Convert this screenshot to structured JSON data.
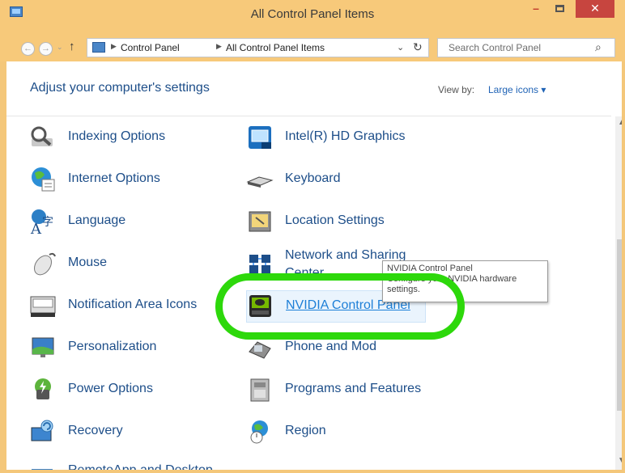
{
  "window": {
    "title": "All Control Panel Items"
  },
  "titlebar_buttons": {
    "minimize": "–",
    "close": "✕"
  },
  "nav": {
    "back": "←",
    "forward": "→",
    "up": "↑",
    "dropdown": "⌄"
  },
  "breadcrumb": [
    "Control Panel",
    "All Control Panel Items"
  ],
  "address": {
    "dropdown_glyph": "⌄",
    "refresh_glyph": "↻"
  },
  "search": {
    "placeholder": "Search Control Panel",
    "icon_glyph": "⌕"
  },
  "header": {
    "title": "Adjust your computer's settings",
    "view_by_label": "View by:",
    "view_by_value": "Large icons ▾"
  },
  "items_left": [
    {
      "label": "Indexing Options",
      "icon": "magnifier-icon"
    },
    {
      "label": "Internet Options",
      "icon": "globe-icon"
    },
    {
      "label": "Language",
      "icon": "language-icon"
    },
    {
      "label": "Mouse",
      "icon": "mouse-icon"
    },
    {
      "label": "Notification Area Icons",
      "icon": "tray-icon"
    },
    {
      "label": "Personalization",
      "icon": "desktop-icon"
    },
    {
      "label": "Power Options",
      "icon": "battery-icon"
    },
    {
      "label": "Recovery",
      "icon": "recovery-icon"
    },
    {
      "label": "RemoteApp and Desktop",
      "icon": "remote-icon"
    }
  ],
  "items_right": [
    {
      "label": "Intel(R) HD Graphics",
      "icon": "intel-icon"
    },
    {
      "label": "Keyboard",
      "icon": "keyboard-icon"
    },
    {
      "label": "Location Settings",
      "icon": "location-icon"
    },
    {
      "label": "Network and Sharing",
      "label2": "Center",
      "icon": "network-icon"
    },
    {
      "label": "NVIDIA Control Panel",
      "icon": "nvidia-icon"
    },
    {
      "label": "Phone and Mod",
      "icon": "phone-icon"
    },
    {
      "label": "Programs and Features",
      "icon": "programs-icon"
    },
    {
      "label": "Region",
      "icon": "region-icon"
    }
  ],
  "tooltip": {
    "title": "NVIDIA Control Panel",
    "body": "Configure your NVIDIA hardware settings."
  },
  "scrollbar": {
    "up": "▲",
    "down": "▼"
  }
}
